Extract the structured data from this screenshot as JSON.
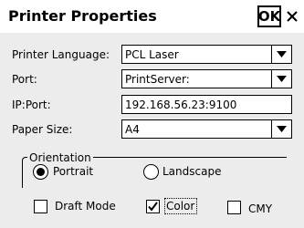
{
  "window": {
    "title": "Printer Properties",
    "ok_label": "OK",
    "close_icon": "close-icon"
  },
  "form": {
    "printer_language": {
      "label": "Printer Language:",
      "value": "PCL Laser"
    },
    "port": {
      "label": "Port:",
      "value": "PrintServer:"
    },
    "ip_port": {
      "label": "IP:Port:",
      "value": "192.168.56.23:9100"
    },
    "paper_size": {
      "label": "Paper Size:",
      "value": "A4"
    }
  },
  "orientation": {
    "legend": "Orientation",
    "options": [
      {
        "label": "Portrait",
        "selected": true
      },
      {
        "label": "Landscape",
        "selected": false
      }
    ]
  },
  "options": [
    {
      "label": "Draft Mode",
      "checked": false
    },
    {
      "label": "Color",
      "checked": true
    },
    {
      "label": "CMY",
      "checked": false
    }
  ],
  "colors": {
    "background": "#ececec",
    "window": "#ffffff",
    "border": "#000000"
  }
}
